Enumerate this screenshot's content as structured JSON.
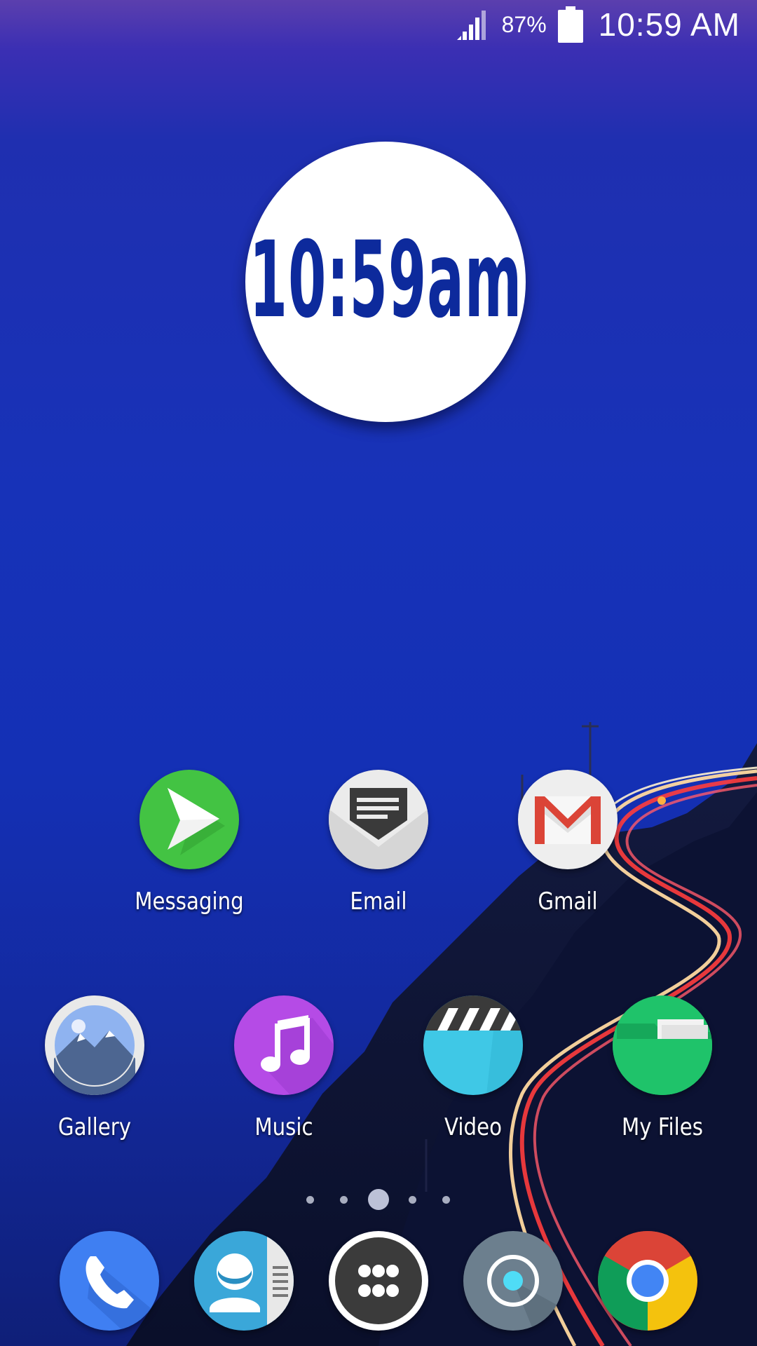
{
  "status_bar": {
    "battery_percent": "87%",
    "time": "10:59 AM",
    "signal_icon": "signal-icon",
    "battery_icon": "battery-icon"
  },
  "clock_widget": {
    "time": "10:59am",
    "color": "#0d2a9c"
  },
  "apps_row1": [
    {
      "label": "Messaging",
      "icon": "messaging-icon",
      "color": "#43c343"
    },
    {
      "label": "Email",
      "icon": "email-icon",
      "color": "#eeeeee"
    },
    {
      "label": "Gmail",
      "icon": "gmail-icon",
      "color": "#eeeeee"
    }
  ],
  "apps_row2": [
    {
      "label": "Gallery",
      "icon": "gallery-icon",
      "color": "#e9e9e9"
    },
    {
      "label": "Music",
      "icon": "music-icon",
      "color": "#b54be6"
    },
    {
      "label": "Video",
      "icon": "video-icon",
      "color": "#3fc8e6"
    },
    {
      "label": "My Files",
      "icon": "folder-icon",
      "color": "#1fc36a"
    }
  ],
  "page_indicator": {
    "pages": 5,
    "current": 3
  },
  "dock": [
    {
      "icon": "phone-icon",
      "color": "#3f7ff2"
    },
    {
      "icon": "contacts-icon",
      "color": "#3aa7d9"
    },
    {
      "icon": "app-drawer-icon",
      "color": "#3b3b3b"
    },
    {
      "icon": "camera-icon",
      "color": "#6c7f8e"
    },
    {
      "icon": "chrome-icon",
      "color": "#db4437"
    }
  ]
}
